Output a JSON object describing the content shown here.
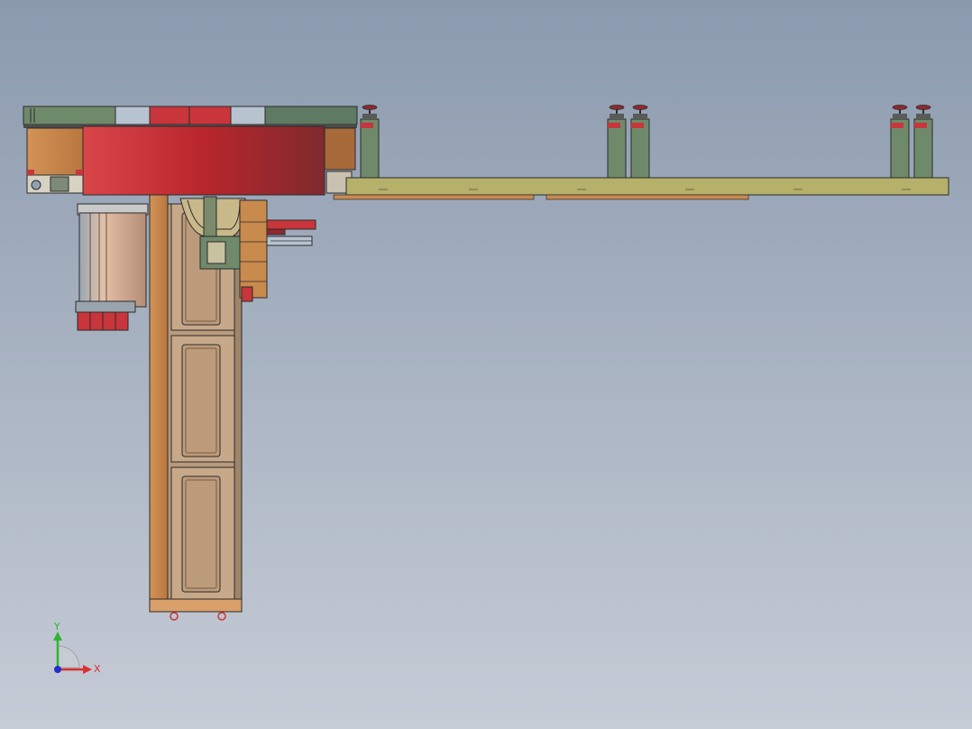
{
  "viewport": {
    "background_top": "#8b9aae",
    "background_bottom": "#c6ccd6"
  },
  "model": {
    "colors": {
      "red": "#c8353b",
      "dark_red": "#8e2a2e",
      "copper": "#c98a4e",
      "light_copper": "#d9a06a",
      "olive": "#b5b06a",
      "green_gray": "#6f8a6a",
      "steel": "#b8c3d0",
      "door": "#c7a98a",
      "cylinder": "#d8b49a"
    }
  },
  "triad": {
    "x_label": "X",
    "y_label": "Y",
    "x_color": "#d93030",
    "y_color": "#2fb52f",
    "z_color": "#2030c8"
  }
}
